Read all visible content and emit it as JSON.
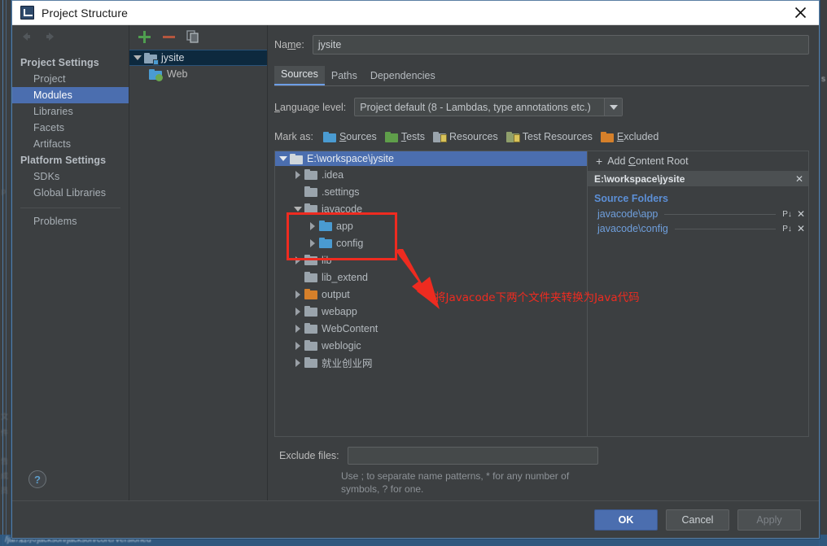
{
  "window": {
    "title": "Project Structure",
    "icon": "intellij-idea-icon",
    "close_label": "×"
  },
  "nav_toolbar": {
    "back_icon": "back-arrow-icon",
    "forward_icon": "forward-arrow-icon"
  },
  "sidebar": {
    "groups": [
      {
        "label": "Project Settings",
        "items": [
          {
            "label": "Project",
            "selected": false
          },
          {
            "label": "Modules",
            "selected": true
          },
          {
            "label": "Libraries",
            "selected": false
          },
          {
            "label": "Facets",
            "selected": false
          },
          {
            "label": "Artifacts",
            "selected": false
          }
        ]
      },
      {
        "label": "Platform Settings",
        "items": [
          {
            "label": "SDKs",
            "selected": false
          },
          {
            "label": "Global Libraries",
            "selected": false
          }
        ]
      }
    ],
    "extra_items": [
      {
        "label": "Problems",
        "selected": false
      }
    ],
    "help_label": "?"
  },
  "modules_panel": {
    "toolbar": [
      {
        "name": "add-module-button",
        "label": "+",
        "color": "#4f9e4f"
      },
      {
        "name": "remove-module-button",
        "label": "−",
        "color": "#b5563e"
      },
      {
        "name": "copy-module-button",
        "label": "copy",
        "color": "#9aa4ac"
      }
    ],
    "tree": [
      {
        "label": "jysite",
        "depth": 0,
        "expanded": true,
        "selected": true,
        "icon": "module-icon"
      },
      {
        "label": "Web",
        "depth": 1,
        "expanded": null,
        "selected": false,
        "icon": "web-facet-icon"
      }
    ]
  },
  "detail": {
    "name_label": "Name:",
    "name_value": "jysite",
    "tabs": [
      {
        "label": "Sources",
        "active": true
      },
      {
        "label": "Paths",
        "active": false
      },
      {
        "label": "Dependencies",
        "active": false
      }
    ],
    "language_level_label": "Language level:",
    "language_level_value": "Project default (8 - Lambdas, type annotations etc.)",
    "mark_as_label": "Mark as:",
    "mark_as_options": [
      {
        "label": "Sources",
        "color": "#4a9bd1",
        "icon": "sources-folder-icon"
      },
      {
        "label": "Tests",
        "color": "#5f9e4a",
        "icon": "tests-folder-icon"
      },
      {
        "label": "Resources",
        "color": "#c4a74b",
        "icon": "resources-folder-icon"
      },
      {
        "label": "Test Resources",
        "color": "#b5b04a",
        "icon": "test-resources-folder-icon"
      },
      {
        "label": "Excluded",
        "color": "#d6802a",
        "icon": "excluded-folder-icon"
      }
    ],
    "content_tree": [
      {
        "label": "E:\\workspace\\jysite",
        "depth": 0,
        "expanded": true,
        "selected": true,
        "color": "gray"
      },
      {
        "label": ".idea",
        "depth": 1,
        "expanded": false,
        "selected": false,
        "color": "gray"
      },
      {
        "label": ".settings",
        "depth": 1,
        "expanded": null,
        "selected": false,
        "color": "gray"
      },
      {
        "label": "javacode",
        "depth": 1,
        "expanded": true,
        "selected": false,
        "color": "gray"
      },
      {
        "label": "app",
        "depth": 2,
        "expanded": false,
        "selected": false,
        "color": "blue"
      },
      {
        "label": "config",
        "depth": 2,
        "expanded": false,
        "selected": false,
        "color": "blue"
      },
      {
        "label": "lib",
        "depth": 1,
        "expanded": false,
        "selected": false,
        "color": "gray"
      },
      {
        "label": "lib_extend",
        "depth": 1,
        "expanded": null,
        "selected": false,
        "color": "gray"
      },
      {
        "label": "output",
        "depth": 1,
        "expanded": false,
        "selected": false,
        "color": "orange"
      },
      {
        "label": "webapp",
        "depth": 1,
        "expanded": false,
        "selected": false,
        "color": "gray"
      },
      {
        "label": "WebContent",
        "depth": 1,
        "expanded": false,
        "selected": false,
        "color": "gray"
      },
      {
        "label": "weblogic",
        "depth": 1,
        "expanded": false,
        "selected": false,
        "color": "gray"
      },
      {
        "label": "就业创业网",
        "depth": 1,
        "expanded": false,
        "selected": false,
        "color": "gray"
      }
    ],
    "add_content_root_label": "Add Content Root",
    "add_content_root_icon": "plus-icon",
    "content_root_header": "E:\\workspace\\jysite",
    "content_root_close": "✕",
    "source_folders_title": "Source Folders",
    "source_folders": [
      {
        "path": "javacode\\app",
        "props_icon": "properties-icon",
        "remove_icon": "remove-icon"
      },
      {
        "path": "javacode\\config",
        "props_icon": "properties-icon",
        "remove_icon": "remove-icon"
      }
    ],
    "exclude_files_label": "Exclude files:",
    "exclude_files_value": "",
    "exclude_hint": "Use ; to separate name patterns, * for any number of symbols, ? for one."
  },
  "footer": {
    "ok": "OK",
    "cancel": "Cancel",
    "apply": "Apply"
  },
  "annotations": {
    "note_text": "将Javacode下两个文件夹转换为Java代码",
    "color": "#ee2b20"
  },
  "backdrop": {
    "status_text": "/jar/泗水/jackson/jackson/core/Versioned",
    "edge_chars": [
      "p",
      "文",
      "件",
      "名",
      "或",
      "i",
      "s"
    ]
  }
}
